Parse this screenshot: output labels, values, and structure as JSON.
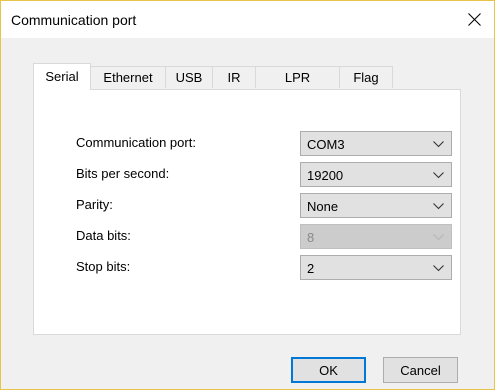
{
  "window": {
    "title": "Communication port"
  },
  "tabs": [
    {
      "label": "Serial",
      "active": true
    },
    {
      "label": "Ethernet",
      "active": false
    },
    {
      "label": "USB",
      "active": false
    },
    {
      "label": "IR",
      "active": false
    },
    {
      "label": "LPR",
      "active": false
    },
    {
      "label": "Flag",
      "active": false
    }
  ],
  "fields": [
    {
      "label": "Communication port:",
      "value": "COM3",
      "enabled": true
    },
    {
      "label": "Bits per second:",
      "value": "19200",
      "enabled": true
    },
    {
      "label": "Parity:",
      "value": "None",
      "enabled": true
    },
    {
      "label": "Data bits:",
      "value": "8",
      "enabled": false
    },
    {
      "label": "Stop bits:",
      "value": "2",
      "enabled": true
    }
  ],
  "buttons": {
    "ok": "OK",
    "cancel": "Cancel"
  },
  "icons": {
    "close": "close-icon",
    "dropdown": "chevron-down-icon"
  },
  "colors": {
    "window_border": "#e8c44a",
    "default_button_border": "#0078d7"
  }
}
